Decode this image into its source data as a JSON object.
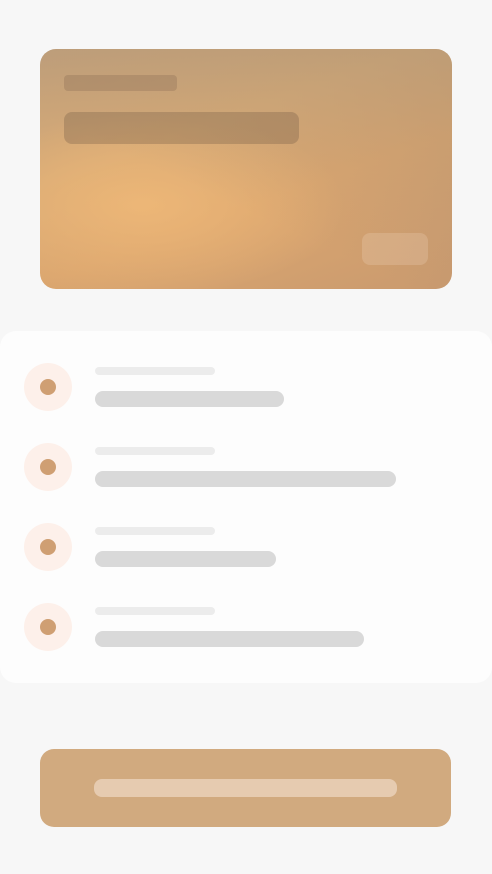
{
  "theme": {
    "background": "#f7f7f7",
    "accent": "#d1aa7f",
    "badge_bg": "#fdf0ea",
    "badge_dot": "#cf9f73",
    "skeleton_light": "#ececec",
    "skeleton_mid": "#d9d9d9"
  },
  "state": "loading-skeleton",
  "hero": {
    "variant": "gradient-card"
  },
  "list": {
    "item_count": 4
  },
  "cta": {
    "label": ""
  }
}
